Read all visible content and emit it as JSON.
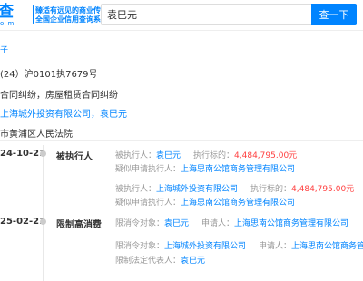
{
  "header": {
    "logo": "查",
    "logo_sub": "o m",
    "slogan_line1": "臻适有远见的商业传奇",
    "slogan_line2": "全国企业信用查询系统",
    "search_value": "袁巳元",
    "search_button": "查一下"
  },
  "case": {
    "tag": "子",
    "case_no": "24）沪0101执7679号",
    "cause": "合同纠纷，房屋租赁合同纠纷",
    "party1": "上海城外投资有限公司",
    "party_sep": "，",
    "party2": "袁巳元",
    "court": "市黄浦区人民法院"
  },
  "timeline": [
    {
      "date": "24-10-21",
      "type": "被执行人",
      "rows": [
        {
          "l1": "被执行人：",
          "v1": "袁巳元",
          "l2": "执行标的：",
          "v2": "4,484,795.00元"
        },
        {
          "l1": "疑似申请执行人：",
          "v1": "上海思南公馆商务管理有限公司"
        },
        {
          "l1": "被执行人：",
          "v1": "上海城外投资有限公司",
          "l2": "执行标的：",
          "v2": "4,484,795.00元"
        },
        {
          "l1": "疑似申请执行人：",
          "v1": "上海思南公馆商务管理有限公司"
        }
      ]
    },
    {
      "date": "25-02-21",
      "type": "限制高消费",
      "rows": [
        {
          "l1": "限消令对象：",
          "v1": "袁巳元",
          "l2": "申请人：",
          "v2": "上海思南公馆商务管理有限公司"
        },
        {
          "l1": "限消令对象：",
          "v1": "上海城外投资有限公司",
          "l2": "申请人：",
          "v2": "上海思南公馆商务管理有"
        },
        {
          "l1": "限制法定代表人：",
          "v1": "袁巳元"
        }
      ]
    }
  ],
  "colors": {
    "brand": "#0084ff",
    "amount": "#ff4040",
    "muted": "#999999"
  }
}
